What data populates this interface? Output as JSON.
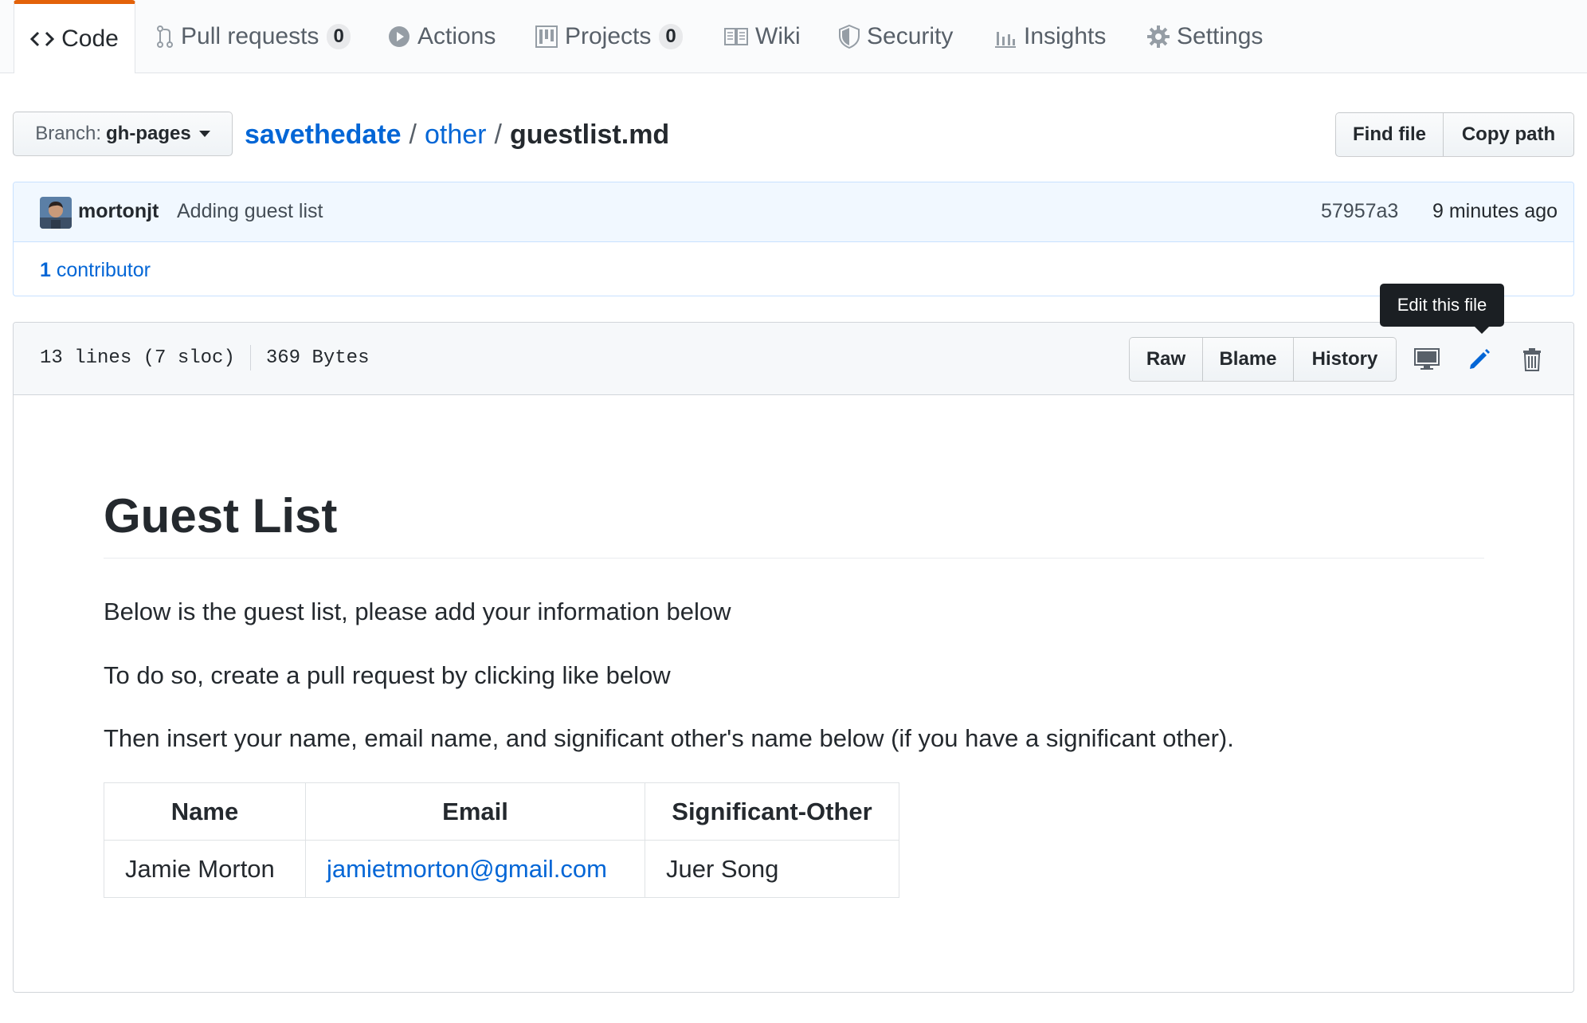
{
  "tabs": [
    {
      "label": "Code",
      "icon": "code-icon",
      "active": true
    },
    {
      "label": "Pull requests",
      "icon": "git-pull-request-icon",
      "count": "0"
    },
    {
      "label": "Actions",
      "icon": "play-icon"
    },
    {
      "label": "Projects",
      "icon": "project-icon",
      "count": "0"
    },
    {
      "label": "Wiki",
      "icon": "book-icon"
    },
    {
      "label": "Security",
      "icon": "shield-icon"
    },
    {
      "label": "Insights",
      "icon": "graph-icon"
    },
    {
      "label": "Settings",
      "icon": "gear-icon"
    }
  ],
  "branch": {
    "prefix": "Branch:",
    "name": "gh-pages"
  },
  "breadcrumb": {
    "repo": "savethedate",
    "folder": "other",
    "file": "guestlist.md",
    "separator": "/"
  },
  "file_nav": {
    "find_file": "Find file",
    "copy_path": "Copy path"
  },
  "commit": {
    "author": "mortonjt",
    "message": "Adding guest list",
    "sha": "57957a3",
    "time": "9 minutes ago",
    "contributors_count": "1",
    "contributors_label": "contributor"
  },
  "file_header": {
    "lines": "13 lines (7 sloc)",
    "size": "369 Bytes",
    "raw": "Raw",
    "blame": "Blame",
    "history": "History",
    "tooltip": "Edit this file",
    "icons": [
      "desktop-icon",
      "pencil-icon",
      "trashcan-icon"
    ]
  },
  "markdown": {
    "title": "Guest List",
    "paragraphs": [
      "Below is the guest list, please add your information below",
      "To do so, create a pull request by clicking like below",
      "Then insert your name, email name, and significant other's name below (if you have a significant other)."
    ],
    "table": {
      "headers": [
        "Name",
        "Email",
        "Significant-Other"
      ],
      "rows": [
        [
          "Jamie Morton",
          "jamietmorton@gmail.com",
          "Juer Song"
        ]
      ]
    }
  },
  "colors": {
    "accent": "#e36209",
    "link": "#0366d6",
    "text": "#24292e",
    "muted": "#586069"
  }
}
